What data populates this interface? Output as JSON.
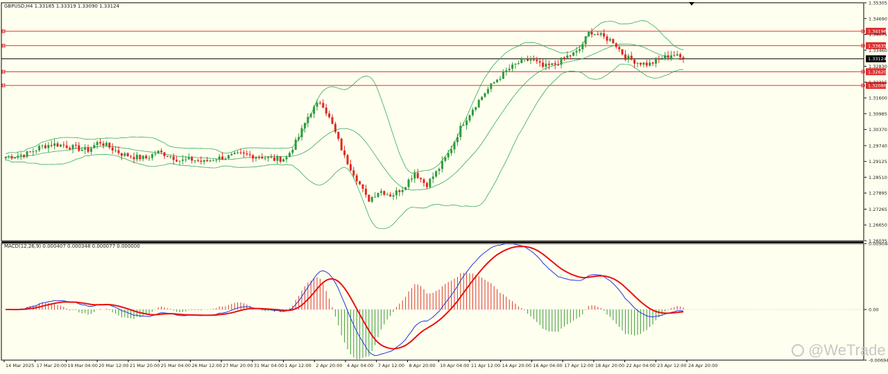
{
  "header": {
    "text": "GBPUSD,H4  1.33185 1.33319 1.33090 1.33124"
  },
  "macd_header": {
    "text": "MACD(12,26,9) 0.000407 0.000348 0.000077 0.000000"
  },
  "watermark": {
    "text": "@WeTrade"
  },
  "colors": {
    "background": "#fffff0",
    "bull": "#2e9b3c",
    "bear": "#e0281e",
    "band": "#33aa55",
    "level": "#e03030",
    "macd_line": "#2233dd",
    "signal_line": "#e81010",
    "hist_pos": "#d83a2a",
    "hist_neg": "#3a9a30",
    "current_price_box": "#000000"
  },
  "chart_data": [
    {
      "type": "candlestick",
      "symbol": "GBPUSD",
      "timeframe": "H4",
      "ylim": [
        1.26035,
        1.35305
      ],
      "y_ticks": [
        "1.35305",
        "1.34690",
        "1.34075",
        "1.33460",
        "1.32830",
        "1.32215",
        "1.31600",
        "1.30985",
        "1.30370",
        "1.29740",
        "1.29125",
        "1.28510",
        "1.27895",
        "1.27265",
        "1.26650",
        "1.26035"
      ],
      "x_ticks": [
        "14 Mar 2025",
        "17 Mar 20:00",
        "19 Mar 04:00",
        "20 Mar 12:00",
        "21 Mar 20:00",
        "25 Mar 04:00",
        "26 Mar 12:00",
        "27 Mar 20:00",
        "31 Mar 04:00",
        "1 Apr 12:00",
        "2 Apr 20:00",
        "4 Apr 04:00",
        "7 Apr 12:00",
        "8 Apr 20:00",
        "10 Apr 04:00",
        "11 Apr 12:00",
        "14 Apr 20:00",
        "16 Apr 04:00",
        "17 Apr 12:00",
        "18 Apr 20:00",
        "22 Apr 04:00",
        "23 Apr 12:00",
        "24 Apr 20:00"
      ],
      "close_path": [
        1.293,
        1.2935,
        1.2945,
        1.297,
        1.298,
        1.2975,
        1.2965,
        1.2955,
        1.299,
        1.2965,
        1.294,
        1.293,
        1.2925,
        1.295,
        1.2935,
        1.2915,
        1.292,
        1.291,
        1.2925,
        1.293,
        1.294,
        1.2935,
        1.293,
        1.292,
        1.2925,
        1.3,
        1.31,
        1.315,
        1.305,
        1.293,
        1.285,
        1.276,
        1.28,
        1.278,
        1.281,
        1.287,
        1.282,
        1.288,
        1.295,
        1.305,
        1.312,
        1.318,
        1.323,
        1.327,
        1.33,
        1.331,
        1.328,
        1.329,
        1.332,
        1.334,
        1.342,
        1.34,
        1.338,
        1.332,
        1.33,
        1.329,
        1.331,
        1.333,
        1.3312
      ],
      "current_price": "1.33124",
      "levels": [
        "1.34196",
        "1.33635",
        "1.32620",
        "1.32086"
      ],
      "bollinger": true
    },
    {
      "type": "macd",
      "name": "MACD(12,26,9)",
      "values": {
        "macd": "0.000407",
        "signal": "0.000348",
        "histogram": "0.000077",
        "other": "0.000000"
      },
      "ylim": [
        -0.006946,
        0.009048
      ],
      "y_ticks": [
        "0.009048",
        "0.00",
        "-0.006946"
      ]
    }
  ]
}
